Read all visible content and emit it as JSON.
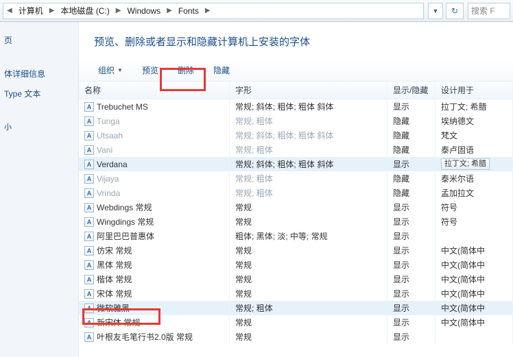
{
  "breadcrumb": {
    "items": [
      "计算机",
      "本地磁盘 (C:)",
      "Windows",
      "Fonts"
    ]
  },
  "search": {
    "placeholder": "搜索 F"
  },
  "sidebar": {
    "items": [
      "页",
      "体详细信息",
      "Type 文本",
      "小"
    ]
  },
  "page_title": "预览、删除或者显示和隐藏计算机上安装的字体",
  "toolbar": {
    "organize": "组织",
    "preview": "预览",
    "delete": "删除",
    "hide": "隐藏"
  },
  "columns": {
    "name": "名称",
    "style": "字形",
    "show": "显示/隐藏",
    "design": "设计用于"
  },
  "rows": [
    {
      "name": "Trebuchet MS",
      "style": "常规; 斜体; 粗体; 粗体 斜体",
      "show": "显示",
      "design": "拉丁文; 希腊",
      "icon": "A",
      "hidden": false
    },
    {
      "name": "Tunga",
      "style": "常规; 粗体",
      "show": "隐藏",
      "design": "埃纳德文",
      "icon": "A",
      "hidden": true
    },
    {
      "name": "Utsaah",
      "style": "常规; 斜体; 粗体; 粗体 斜体",
      "show": "隐藏",
      "design": "梵文",
      "icon": "A",
      "hidden": true
    },
    {
      "name": "Vani",
      "style": "常规; 粗体",
      "show": "隐藏",
      "design": "泰卢固语",
      "icon": "A",
      "hidden": true
    },
    {
      "name": "Verdana",
      "style": "常规; 斜体; 粗体; 粗体 斜体",
      "show": "显示",
      "design": "拉丁文; 希腊",
      "icon": "A",
      "hidden": false,
      "selected": true,
      "designButton": true
    },
    {
      "name": "Vijaya",
      "style": "常规; 粗体",
      "show": "隐藏",
      "design": "泰米尔语",
      "icon": "A",
      "hidden": true
    },
    {
      "name": "Vrinda",
      "style": "常规; 粗体",
      "show": "隐藏",
      "design": "孟加拉文",
      "icon": "A",
      "hidden": true
    },
    {
      "name": "Webdings 常规",
      "style": "常规",
      "show": "显示",
      "design": "符号",
      "icon": "A",
      "hidden": false
    },
    {
      "name": "Wingdings 常规",
      "style": "常规",
      "show": "显示",
      "design": "符号",
      "icon": "A",
      "hidden": false
    },
    {
      "name": "阿里巴巴普惠体",
      "style": "粗体; 黑体; 淡; 中等; 常规",
      "show": "显示",
      "design": "",
      "icon": "A",
      "hidden": false
    },
    {
      "name": "仿宋 常规",
      "style": "常规",
      "show": "显示",
      "design": "中文(简体中",
      "icon": "A",
      "hidden": false
    },
    {
      "name": "黑体 常规",
      "style": "常规",
      "show": "显示",
      "design": "中文(简体中",
      "icon": "A",
      "hidden": false
    },
    {
      "name": "楷体 常规",
      "style": "常规",
      "show": "显示",
      "design": "中文(简体中",
      "icon": "A",
      "hidden": false
    },
    {
      "name": "宋体 常规",
      "style": "常规",
      "show": "显示",
      "design": "中文(简体中",
      "icon": "A",
      "hidden": false
    },
    {
      "name": "微软雅黑",
      "style": "常规; 粗体",
      "show": "显示",
      "design": "中文(简体中",
      "icon": "A",
      "hidden": false,
      "selected": true
    },
    {
      "name": "新宋体 常规",
      "style": "常规",
      "show": "显示",
      "design": "中文(简体中",
      "icon": "A",
      "hidden": false
    },
    {
      "name": "叶根友毛笔行书2.0版 常规",
      "style": "常规",
      "show": "显示",
      "design": "",
      "icon": "A",
      "hidden": false
    }
  ]
}
